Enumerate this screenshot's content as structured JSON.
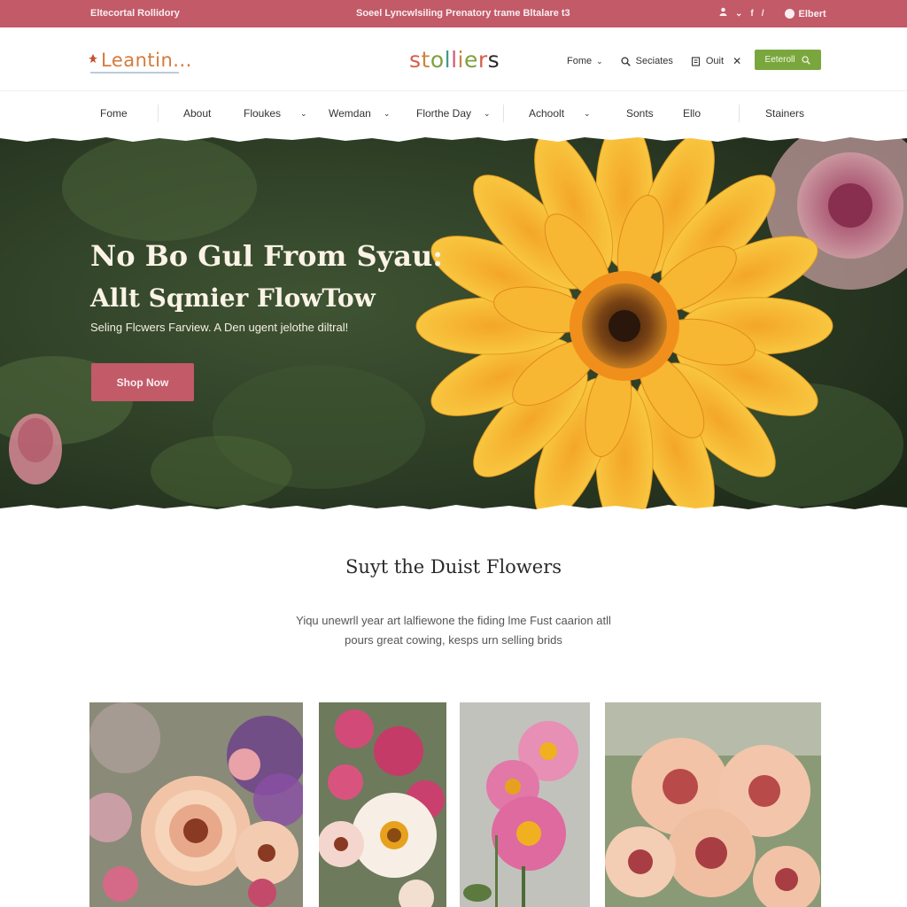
{
  "topbar": {
    "left_text": "Eltecortal Rollidory",
    "center_text": "Soeel Lyncwlsiling Prenatory trame Bltalare t3",
    "user_label": "Elbert",
    "icons": [
      "person-icon",
      "chevron-icon",
      "slash-icon",
      "dot-icon"
    ]
  },
  "header": {
    "left_logo": "Leantin...",
    "center_logo_letters": [
      "s",
      "t",
      "o",
      "l",
      "l",
      "i",
      "e",
      "r",
      "s"
    ],
    "menu_home": "Fome",
    "menu_search": "Seciates",
    "menu_out": "Ouit",
    "search_button": "Eeteroll"
  },
  "nav": {
    "items": [
      {
        "label": "Fome",
        "dropdown": false
      },
      {
        "label": "About",
        "dropdown": false
      },
      {
        "label": "Floukes",
        "dropdown": true
      },
      {
        "label": "Wemdan",
        "dropdown": true
      },
      {
        "label": "Florthe Day",
        "dropdown": true
      },
      {
        "label": "Achoolt",
        "dropdown": true
      },
      {
        "label": "Sonts",
        "dropdown": false
      },
      {
        "label": "Ello",
        "dropdown": false
      },
      {
        "label": "Stainers",
        "dropdown": false
      }
    ]
  },
  "hero": {
    "headline": "No Bo Gul From Syau:",
    "subheadline": "Allt Sqmier FlowTow",
    "tagline": "Seling Flcwers Farview. A Den ugent jelothe diltral!",
    "cta": "Shop Now"
  },
  "intro": {
    "title": "Suyt the Duist Flowers",
    "line1": "Yiqu unewrll year art lalfiewone the fiding lme Fust caarion atll",
    "line2": "pours great cowing, kesps urn selling brids"
  },
  "colors": {
    "brand_rose": "#c25a68",
    "accent_green": "#7aa73d",
    "hero_text": "#faf3e6"
  },
  "gallery": [
    {
      "name": "peach-dahlia-card"
    },
    {
      "name": "pink-white-daisy-card"
    },
    {
      "name": "pink-cosmos-card"
    },
    {
      "name": "salmon-dahlia-card"
    }
  ]
}
